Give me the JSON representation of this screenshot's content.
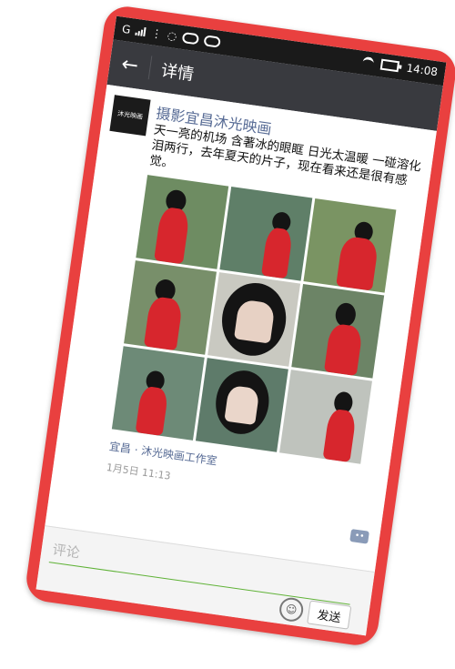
{
  "status_bar": {
    "carrier": "G",
    "time": "14:08"
  },
  "header": {
    "title": "详情"
  },
  "post": {
    "author": "摄影宜昌沐光映画",
    "avatar_text": "沐光映画",
    "text": "天一亮的机场 含著冰的眼眶 日光太温暖 一碰溶化泪两行，去年夏天的片子，现在看来还是很有感觉。",
    "location": "宜昌 · 沐光映画工作室",
    "time": "1月5日 11:13",
    "photos": [
      {
        "icon": "photo-red-dress"
      },
      {
        "icon": "photo-red-dress"
      },
      {
        "icon": "photo-red-dress"
      },
      {
        "icon": "photo-red-dress"
      },
      {
        "icon": "photo-portrait"
      },
      {
        "icon": "photo-red-dress"
      },
      {
        "icon": "photo-red-dress"
      },
      {
        "icon": "photo-portrait"
      },
      {
        "icon": "photo-red-dress"
      }
    ]
  },
  "comment_bar": {
    "placeholder": "评论",
    "send_label": "发送"
  },
  "colors": {
    "phone_frame": "#e9403f",
    "header_bg": "#393a3f",
    "link": "#576b95",
    "accent_green": "#5fb236"
  }
}
